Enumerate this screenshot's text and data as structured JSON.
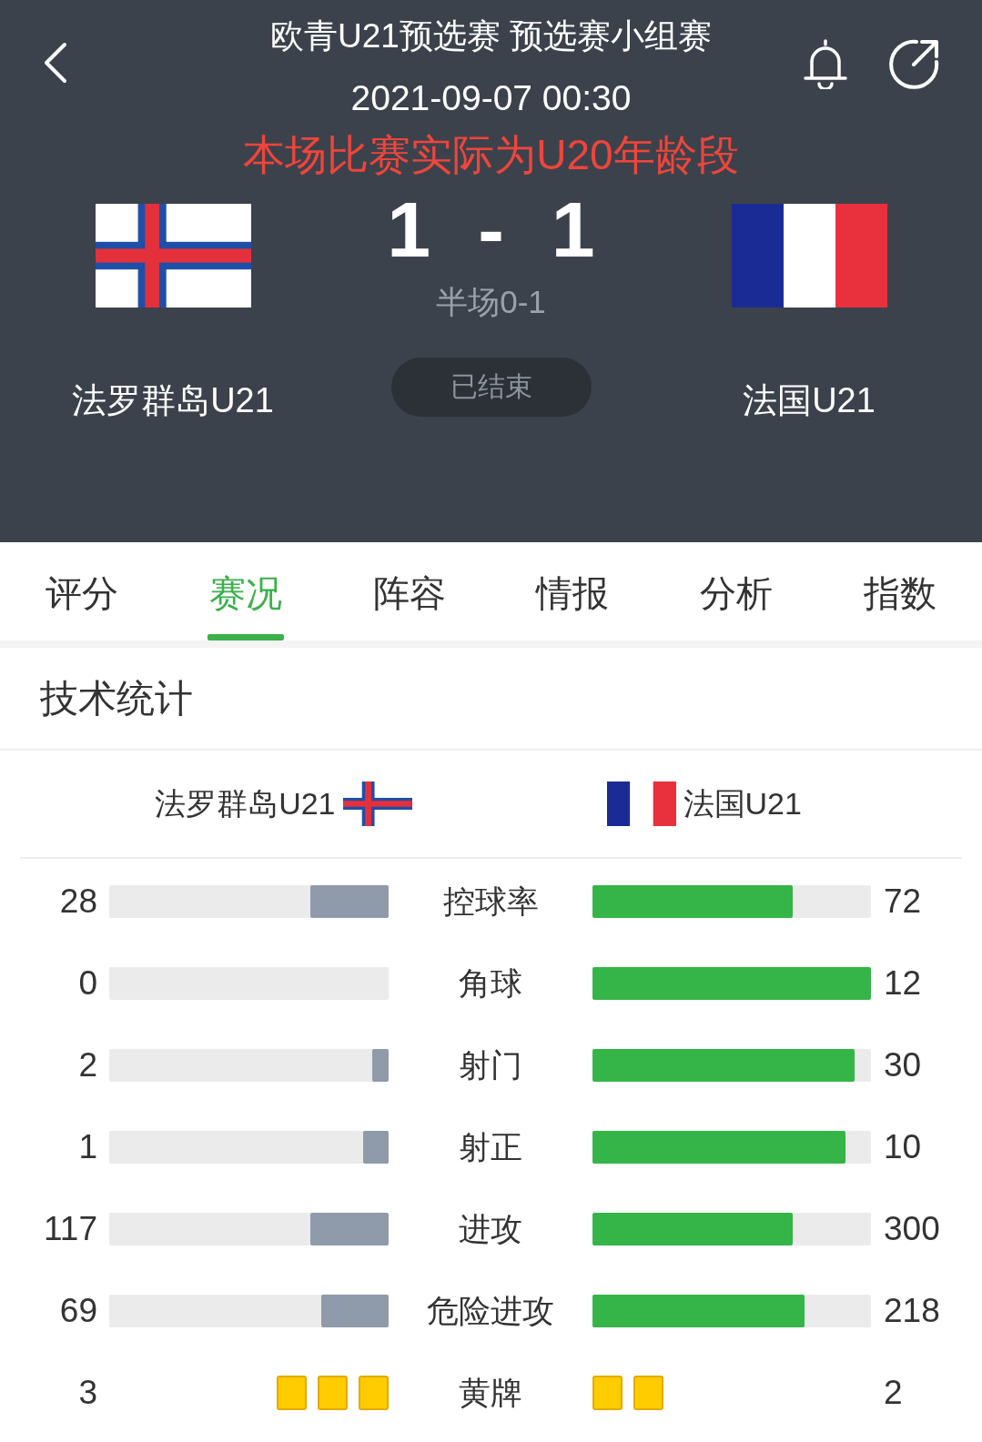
{
  "header": {
    "competition": "欧青U21预选赛 预选赛小组赛",
    "kickoff": "2021-09-07 00:30",
    "notice": "本场比赛实际为U20年龄段"
  },
  "match": {
    "home": {
      "name": "法罗群岛U21",
      "flag": {
        "kind": "nordic-cross"
      }
    },
    "away": {
      "name": "法国U21",
      "flag": {
        "kind": "tricolor"
      }
    },
    "score": {
      "home": "1",
      "separator": "-",
      "away": "1"
    },
    "half_time": "半场0-1",
    "status": "已结束"
  },
  "tabs": [
    {
      "label": "评分",
      "selected": false
    },
    {
      "label": "赛况",
      "selected": true
    },
    {
      "label": "阵容",
      "selected": false
    },
    {
      "label": "情报",
      "selected": false
    },
    {
      "label": "分析",
      "selected": false
    },
    {
      "label": "指数",
      "selected": false
    }
  ],
  "stats": {
    "title": "技术统计",
    "home": {
      "name": "法罗群岛U21",
      "flag": {
        "kind": "nordic-cross"
      }
    },
    "away": {
      "name": "法国U21",
      "flag": {
        "kind": "tricolor"
      }
    },
    "rows": [
      {
        "kind": "bar",
        "label": "控球率",
        "home": {
          "value": "28",
          "level": 0.28
        },
        "away": {
          "value": "72",
          "level": 0.72
        }
      },
      {
        "kind": "bar",
        "label": "角球",
        "home": {
          "value": "0"
        },
        "away": {
          "value": "12",
          "level": 1
        }
      },
      {
        "kind": "bar",
        "label": "射门",
        "home": {
          "value": "2",
          "level": 0.06
        },
        "away": {
          "value": "30",
          "level": 0.94
        }
      },
      {
        "kind": "bar",
        "label": "射正",
        "home": {
          "value": "1",
          "level": 0.09
        },
        "away": {
          "value": "10",
          "level": 0.91
        }
      },
      {
        "kind": "bar",
        "label": "进攻",
        "home": {
          "value": "117",
          "level": 0.28
        },
        "away": {
          "value": "300",
          "level": 0.72
        }
      },
      {
        "kind": "bar",
        "label": "危险进攻",
        "home": {
          "value": "69",
          "level": 0.24
        },
        "away": {
          "value": "218",
          "level": 0.76
        }
      },
      {
        "kind": "cards",
        "label": "黄牌",
        "home": {
          "value": "3",
          "cards": [
            {
              "kind": "yellow"
            },
            {
              "kind": "yellow"
            },
            {
              "kind": "yellow"
            }
          ]
        },
        "away": {
          "value": "2",
          "cards": [
            {
              "kind": "yellow"
            },
            {
              "kind": "yellow"
            }
          ]
        }
      }
    ]
  }
}
